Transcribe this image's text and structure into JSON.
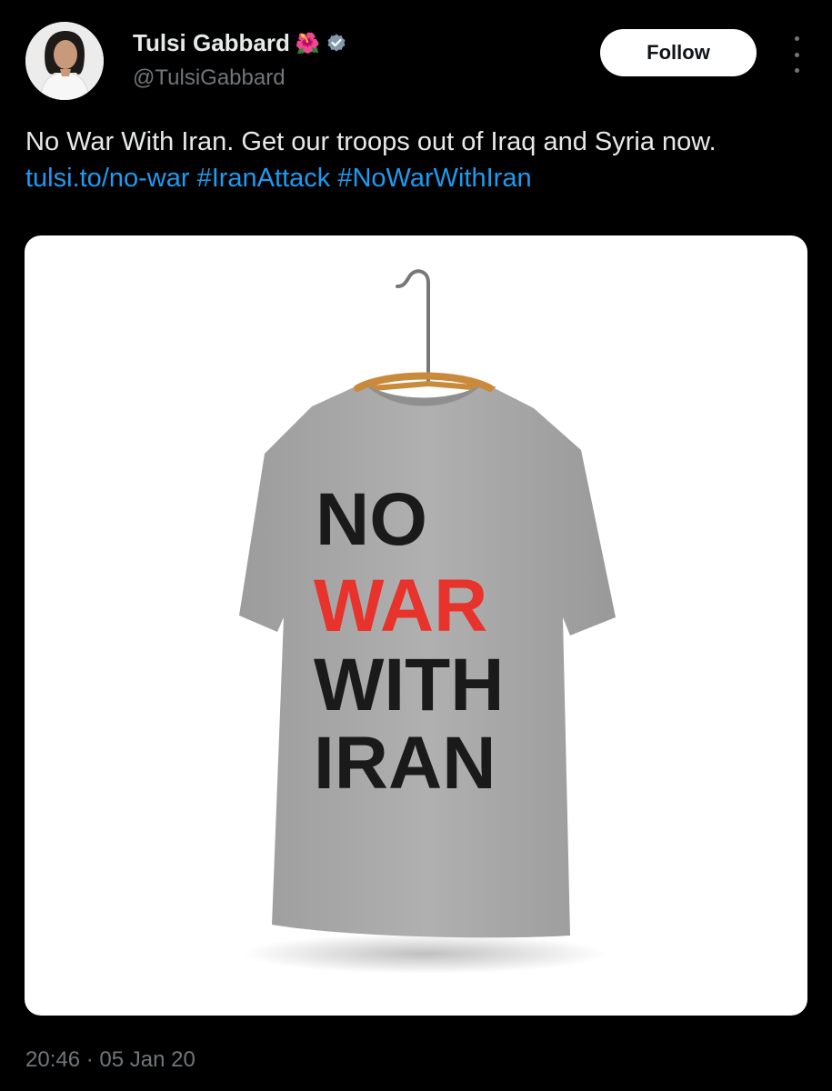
{
  "author": {
    "display_name": "Tulsi Gabbard",
    "emoji": "🌺",
    "handle": "@TulsiGabbard",
    "verified_badge_color": "#829aab"
  },
  "actions": {
    "follow_label": "Follow"
  },
  "tweet": {
    "text": "No War With Iran. Get our troops out of Iraq and Syria now.",
    "link": "tulsi.to/no-war",
    "hashtags": [
      "#IranAttack",
      "#NoWarWithIran"
    ]
  },
  "media": {
    "shirt_lines": [
      "NO",
      "WAR",
      "WITH",
      "IRAN"
    ],
    "shirt_color": "#a6a6a6",
    "text_color": "#1a1a1a",
    "accent_color": "#e8322c"
  },
  "meta": {
    "timestamp": "20:46 · 05 Jan 20"
  },
  "colors": {
    "background": "#000000",
    "link": "#1d9bf0",
    "muted": "#71767b"
  }
}
